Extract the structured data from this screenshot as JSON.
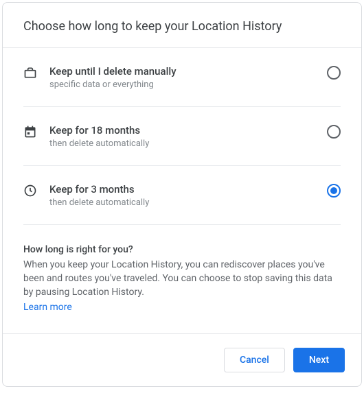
{
  "header": {
    "title": "Choose how long to keep your Location History"
  },
  "options": [
    {
      "title": "Keep until I delete manually",
      "sub": "specific data or everything",
      "selected": false,
      "icon": "briefcase-icon"
    },
    {
      "title": "Keep for 18 months",
      "sub": "then delete automatically",
      "selected": false,
      "icon": "calendar-icon"
    },
    {
      "title": "Keep for 3 months",
      "sub": "then delete automatically",
      "selected": true,
      "icon": "clock-icon"
    }
  ],
  "info": {
    "title": "How long is right for you?",
    "body": "When you keep your Location History, you can rediscover places you've been and routes you've traveled. You can choose to stop saving this data by pausing Location History.",
    "learn_more": "Learn more"
  },
  "footer": {
    "cancel": "Cancel",
    "next": "Next"
  }
}
